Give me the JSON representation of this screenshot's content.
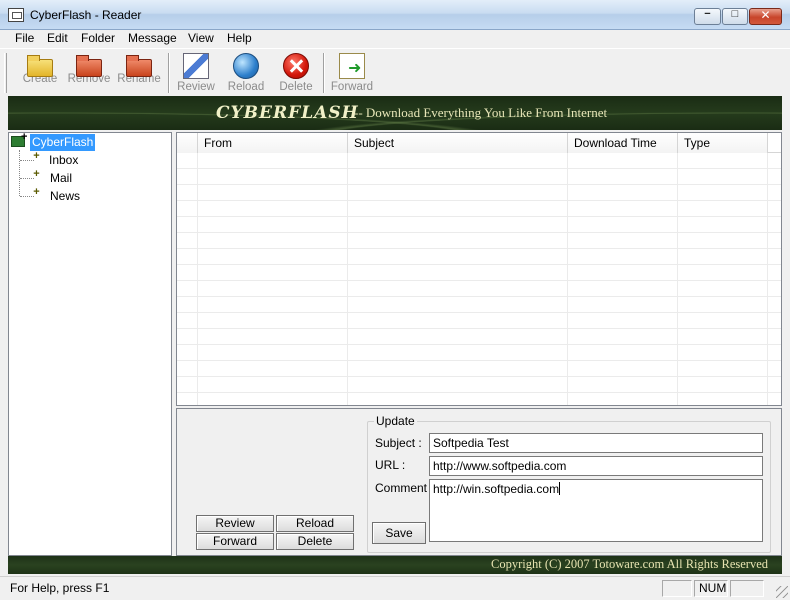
{
  "window": {
    "title": "CyberFlash - Reader",
    "controls": {
      "minimize": "−",
      "maximize": "□",
      "close": "✕"
    }
  },
  "menu": [
    "File",
    "Edit",
    "Folder",
    "Message",
    "View",
    "Help"
  ],
  "toolbar": {
    "buttons": [
      {
        "label": "Create",
        "icon": "folder-icon",
        "enabled": false
      },
      {
        "label": "Remove",
        "icon": "folder-remove-icon",
        "enabled": false
      },
      {
        "label": "Rename",
        "icon": "folder-rename-icon",
        "enabled": false
      },
      {
        "label": "Review",
        "icon": "pen-icon",
        "enabled": false
      },
      {
        "label": "Reload",
        "icon": "globe-icon",
        "enabled": false
      },
      {
        "label": "Delete",
        "icon": "delete-icon",
        "enabled": false
      },
      {
        "label": "Forward",
        "icon": "forward-icon",
        "enabled": false
      }
    ]
  },
  "banner": {
    "title": "CYBERFLASH",
    "tagline": "-- Download Everything You Like From Internet"
  },
  "tree": {
    "root": "CyberFlash",
    "children": [
      "Inbox",
      "Mail",
      "News"
    ]
  },
  "message_list": {
    "columns": [
      "From",
      "Subject",
      "Download Time",
      "Type"
    ],
    "rows": []
  },
  "actions": {
    "review": "Review",
    "reload": "Reload",
    "forward": "Forward",
    "delete": "Delete"
  },
  "update_form": {
    "legend": "Update",
    "subject_label": "Subject :",
    "subject_value": "Softpedia Test",
    "url_label": "URL :",
    "url_value": "http://www.softpedia.com",
    "comment_label": "Comment :",
    "comment_value": "http://win.softpedia.com",
    "save": "Save"
  },
  "footer": {
    "copyright": "Copyright (C) 2007 Totoware.com All Rights Reserved"
  },
  "status": {
    "help_text": "For Help, press F1",
    "num": "NUM"
  },
  "colors": {
    "banner_bg": "#1f3419",
    "banner_text": "#f1f1c8",
    "selection": "#3399ff"
  }
}
